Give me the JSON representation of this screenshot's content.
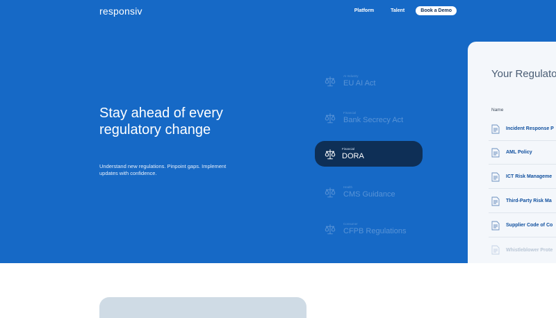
{
  "brand": {
    "logo": "responsiv"
  },
  "nav": {
    "items": [
      {
        "label": "Platform"
      },
      {
        "label": "Talent"
      }
    ],
    "cta": "Book a Demo"
  },
  "hero": {
    "headline": "Stay ahead of every regulatory change",
    "subtext": "Understand new regulations. Pinpoint gaps. Implement updates with confidence."
  },
  "regulations": [
    {
      "category": "AI Industry",
      "name": "EU AI Act",
      "active": false
    },
    {
      "category": "Financial",
      "name": "Bank Secrecy Act",
      "active": false
    },
    {
      "category": "Financial",
      "name": "DORA",
      "active": true
    },
    {
      "category": "Health",
      "name": "CMS Guidance",
      "active": false
    },
    {
      "category": "Consumer",
      "name": "CFPB Regulations",
      "active": false
    }
  ],
  "panel": {
    "title": "Your Regulatory",
    "column_header": "Name",
    "documents": [
      "Incident Response P",
      "AML Policy",
      "ICT Risk Manageme",
      "Third-Party Risk Ma",
      "Supplier Code of Co",
      "Whistleblower Prote"
    ]
  },
  "colors": {
    "hero_bg": "#1669c6",
    "active_pill": "#0e2f56",
    "panel_bg": "#f4f7fb",
    "doc_link": "#0f4f9e"
  }
}
